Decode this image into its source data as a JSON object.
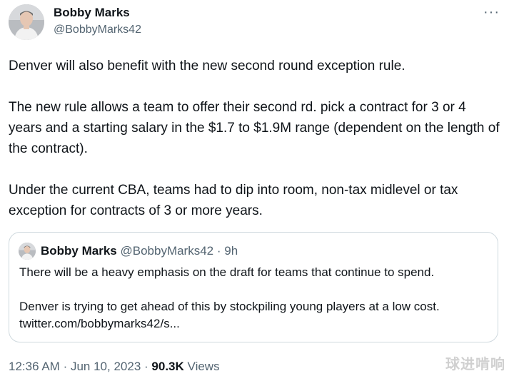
{
  "author": {
    "name": "Bobby Marks",
    "handle": "@BobbyMarks42"
  },
  "more_icon": "more-horizontal-icon",
  "tweet": {
    "paragraphs": [
      "Denver will also benefit with the new second round exception rule.",
      "The new rule allows a team to offer their second rd. pick a contract for 3 or 4 years and a starting salary in the $1.7 to $1.9M range (dependent on the length of the contract).",
      "Under the current CBA, teams had to dip into room, non-tax midlevel or tax exception for contracts of 3 or more years."
    ]
  },
  "quote": {
    "name": "Bobby Marks",
    "handle": "@BobbyMarks42",
    "separator": "·",
    "time": "9h",
    "line1": "There will be a heavy emphasis on the draft for teams that continue to spend.",
    "line2": "Denver is trying to get ahead of this by stockpiling young players at a low cost.",
    "link": "twitter.com/bobbymarks42/s..."
  },
  "meta": {
    "time": "12:36 AM",
    "sep1": "·",
    "date": "Jun 10, 2023",
    "sep2": "·",
    "views_count": "90.3K",
    "views_label": "Views"
  },
  "watermark": "球进啃响",
  "colors": {
    "text": "#0f1419",
    "secondary": "#536471",
    "border": "#cfd9de"
  }
}
